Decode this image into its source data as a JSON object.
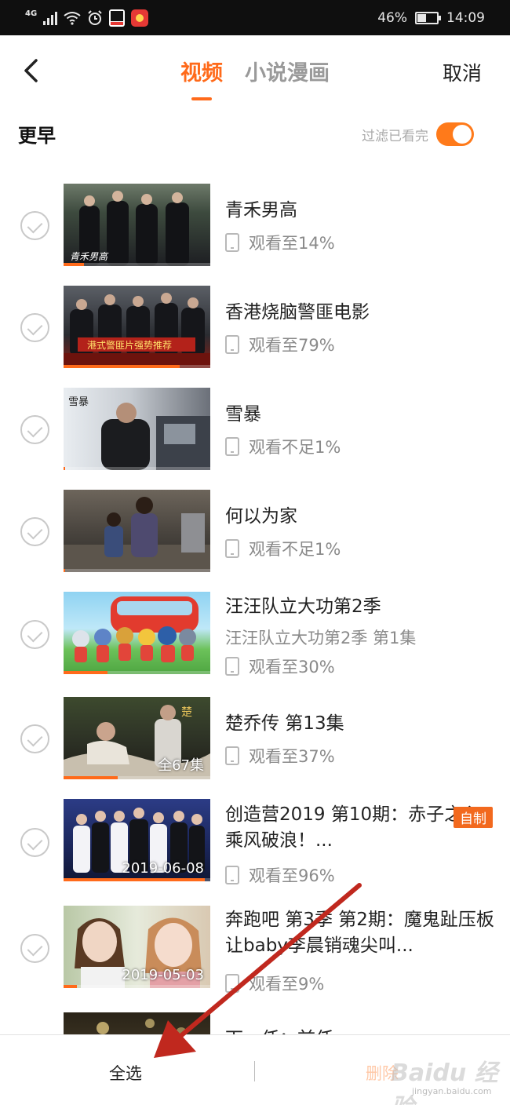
{
  "status_bar": {
    "network": "4G",
    "battery": "46%",
    "time": "14:09"
  },
  "header": {
    "tabs": [
      {
        "label": "视频",
        "active": true
      },
      {
        "label": "小说漫画",
        "active": false
      }
    ],
    "cancel": "取消"
  },
  "section": {
    "title": "更早",
    "filter_label": "过滤已看完",
    "filter_on": true
  },
  "items": [
    {
      "title": "青禾男高",
      "progress": "观看至14%"
    },
    {
      "title": "香港烧脑警匪电影",
      "progress": "观看至79%"
    },
    {
      "title": "雪暴",
      "progress": "观看不足1%"
    },
    {
      "title": "何以为家",
      "progress": "观看不足1%"
    },
    {
      "title": "汪汪队立大功第2季",
      "subtitle": "汪汪队立大功第2季 第1集",
      "progress": "观看至30%"
    },
    {
      "title": "楚乔传 第13集",
      "progress": "观看至37%",
      "thumb_text": "全67集"
    },
    {
      "title": "创造营2019 第10期：赤子之心乘风破浪！...",
      "progress": "观看至96%",
      "thumb_text": "2019-06-08",
      "badge": "自制"
    },
    {
      "title": "奔跑吧 第3季 第2期：魔鬼趾压板让baby李晨销魂尖叫...",
      "progress": "观看至9%",
      "thumb_text": "2019-05-03"
    },
    {
      "title": "下一任：前任"
    }
  ],
  "bottom_bar": {
    "select_all": "全选",
    "delete": "删除"
  },
  "watermark": {
    "text": "Baidu 经验",
    "url": "jingyan.baidu.com"
  },
  "colors": {
    "accent": "#ff6a1a",
    "annotation": "#c0281e"
  }
}
